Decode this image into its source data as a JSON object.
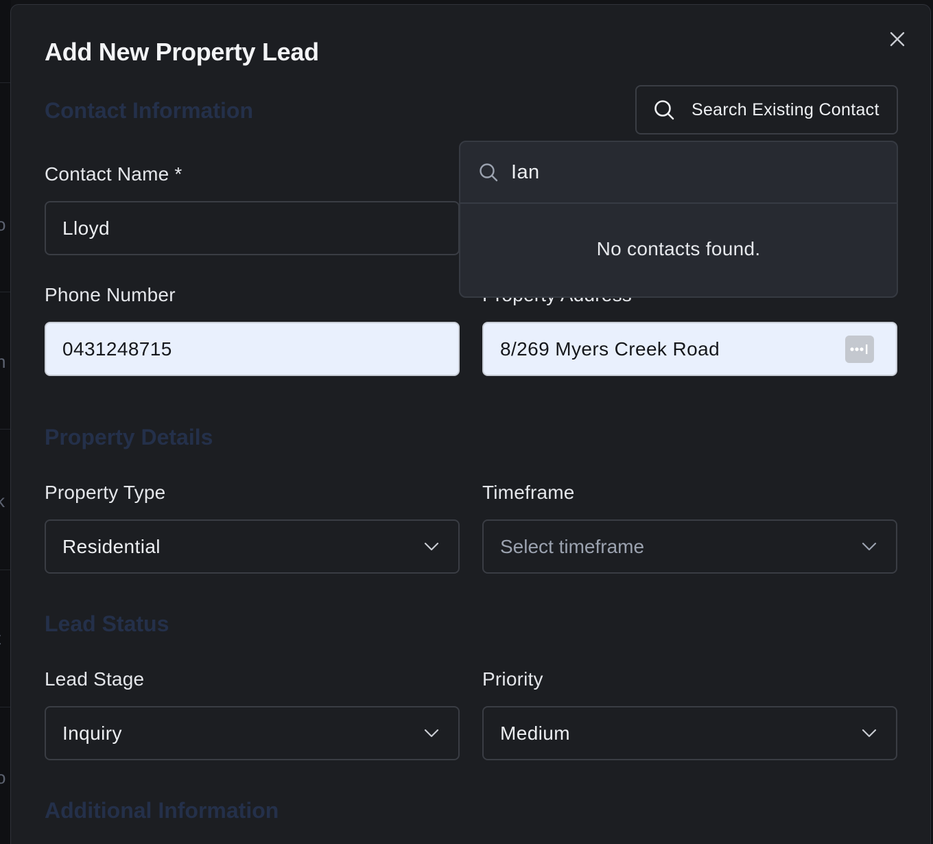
{
  "modal": {
    "title": "Add New Property Lead",
    "close_icon": "close-icon"
  },
  "sections": {
    "contact": "Contact Information",
    "property": "Property Details",
    "lead": "Lead Status",
    "additional": "Additional Information"
  },
  "search_contact": {
    "button_label": "Search Existing Contact",
    "icon": "search-icon",
    "query": "Ian",
    "empty_message": "No contacts found."
  },
  "fields": {
    "contact_name": {
      "label": "Contact Name *",
      "value": "Lloyd"
    },
    "phone": {
      "label": "Phone Number",
      "value": "0431248715"
    },
    "address": {
      "label": "Property Address",
      "value": "8/269 Myers Creek Road"
    },
    "property_type": {
      "label": "Property Type",
      "value": "Residential"
    },
    "timeframe": {
      "label": "Timeframe",
      "placeholder": "Select timeframe"
    },
    "lead_stage": {
      "label": "Lead Stage",
      "value": "Inquiry"
    },
    "priority": {
      "label": "Priority",
      "value": "Medium"
    }
  },
  "backdrop_glyphs": [
    "o",
    "n",
    "k",
    "t",
    "o"
  ],
  "colors": {
    "modal_bg": "#1c1e22",
    "autofill_bg": "#e9f0fd",
    "section_heading": "#24304a",
    "dropdown_bg": "#272a31"
  }
}
